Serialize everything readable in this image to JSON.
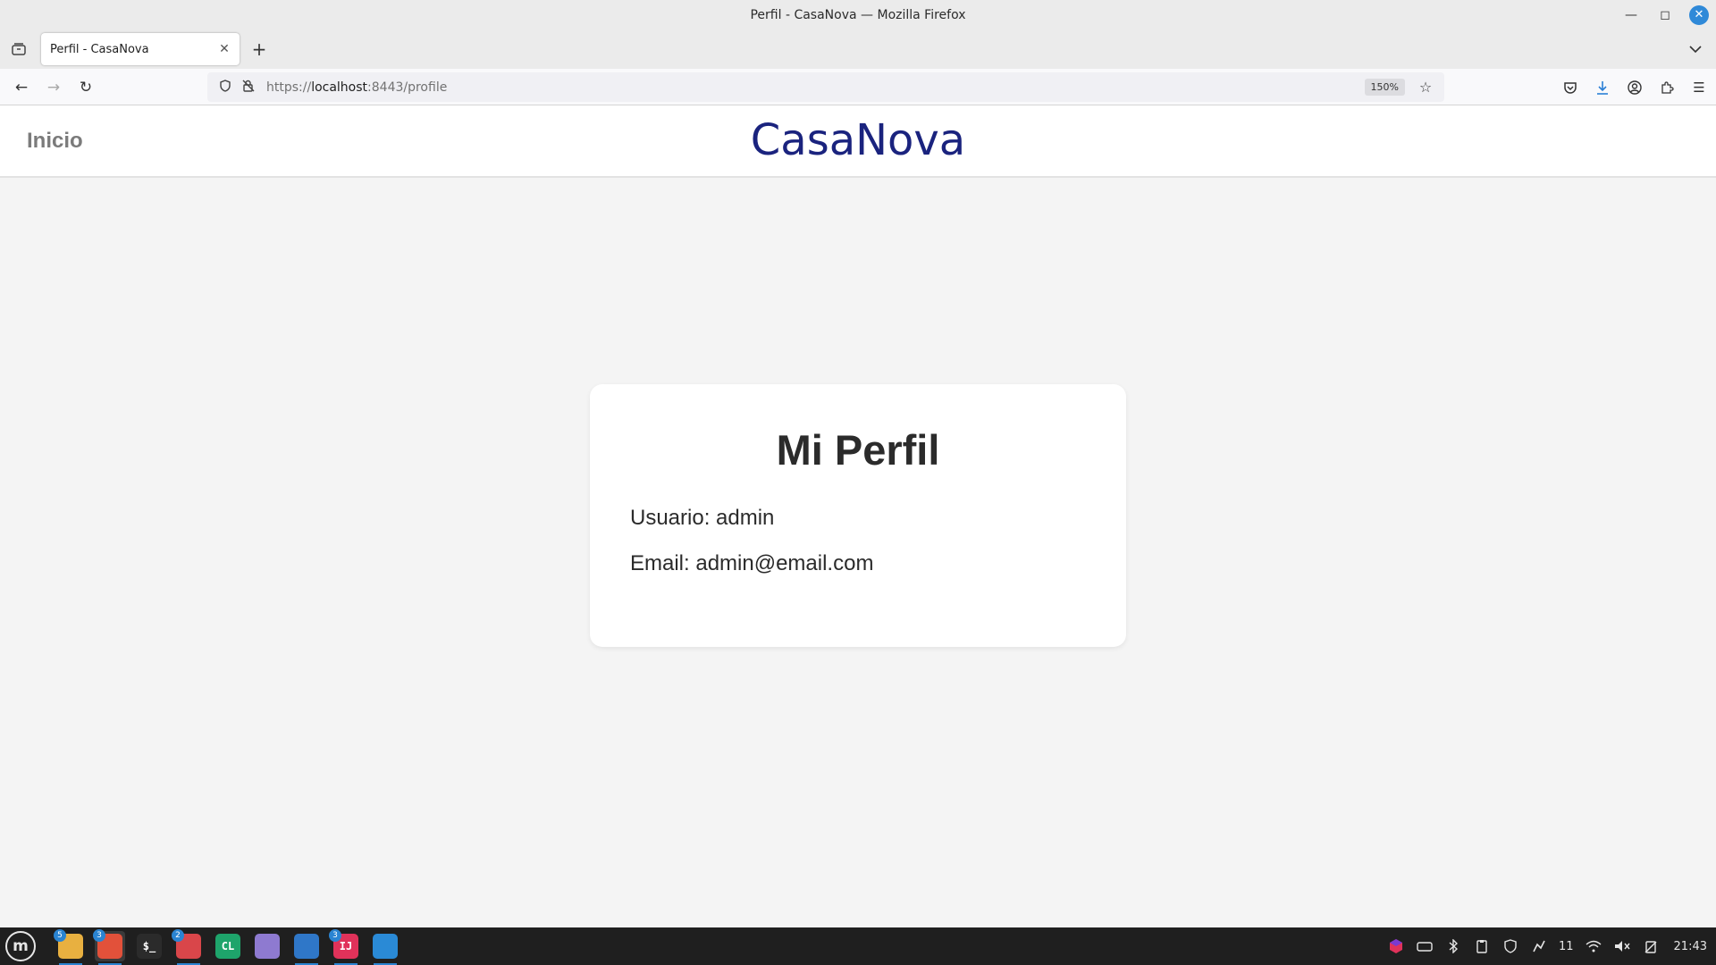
{
  "window": {
    "title": "Perfil - CasaNova — Mozilla Firefox"
  },
  "tabs": [
    {
      "label": "Perfil - CasaNova"
    }
  ],
  "urlbar": {
    "url_prefix": "https://",
    "url_host": "localhost",
    "url_rest": ":8443/profile",
    "zoom": "150%"
  },
  "site": {
    "home_link": "Inicio",
    "brand": "CasaNova"
  },
  "profile": {
    "title": "Mi Perfil",
    "user_line": "Usuario: admin",
    "email_line": "Email: admin@email.com"
  },
  "taskbar": {
    "apps": [
      {
        "name": "files",
        "badge": "5",
        "color": "#e8b040",
        "glyph": ""
      },
      {
        "name": "firefox",
        "badge": "3",
        "color": "#e2513a",
        "glyph": ""
      },
      {
        "name": "terminal",
        "badge": "",
        "color": "#2b2b2b",
        "glyph": "$_"
      },
      {
        "name": "hypnotix",
        "badge": "2",
        "color": "#d9464a",
        "glyph": ""
      },
      {
        "name": "clion",
        "badge": "",
        "color": "#1ea46b",
        "glyph": "CL"
      },
      {
        "name": "text-editor",
        "badge": "",
        "color": "#8e7ad0",
        "glyph": ""
      },
      {
        "name": "writer",
        "badge": "",
        "color": "#2f77c8",
        "glyph": ""
      },
      {
        "name": "intellij",
        "badge": "3",
        "color": "#e0325a",
        "glyph": "IJ"
      },
      {
        "name": "vscode",
        "badge": "",
        "color": "#2a8ad6",
        "glyph": ""
      }
    ],
    "tray_count": "11",
    "clock": "21:43"
  }
}
